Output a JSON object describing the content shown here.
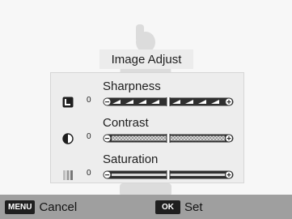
{
  "dialog": {
    "title": "Image Adjust"
  },
  "adjustments": [
    {
      "label": "Sharpness",
      "value": "0",
      "icon": "sharpness-icon",
      "level": 0.5
    },
    {
      "label": "Contrast",
      "value": "0",
      "icon": "contrast-icon",
      "level": 0.5
    },
    {
      "label": "Saturation",
      "value": "0",
      "icon": "saturation-icon",
      "level": 0.5
    }
  ],
  "soft_keys": {
    "menu": {
      "badge": "MENU",
      "label": "Cancel"
    },
    "ok": {
      "badge": "OK",
      "label": "Set"
    }
  },
  "colors": {
    "bar": "#9f9f9f",
    "panel": "#ededed",
    "badge": "#1f1f1f",
    "track": "#4a4a4a"
  }
}
